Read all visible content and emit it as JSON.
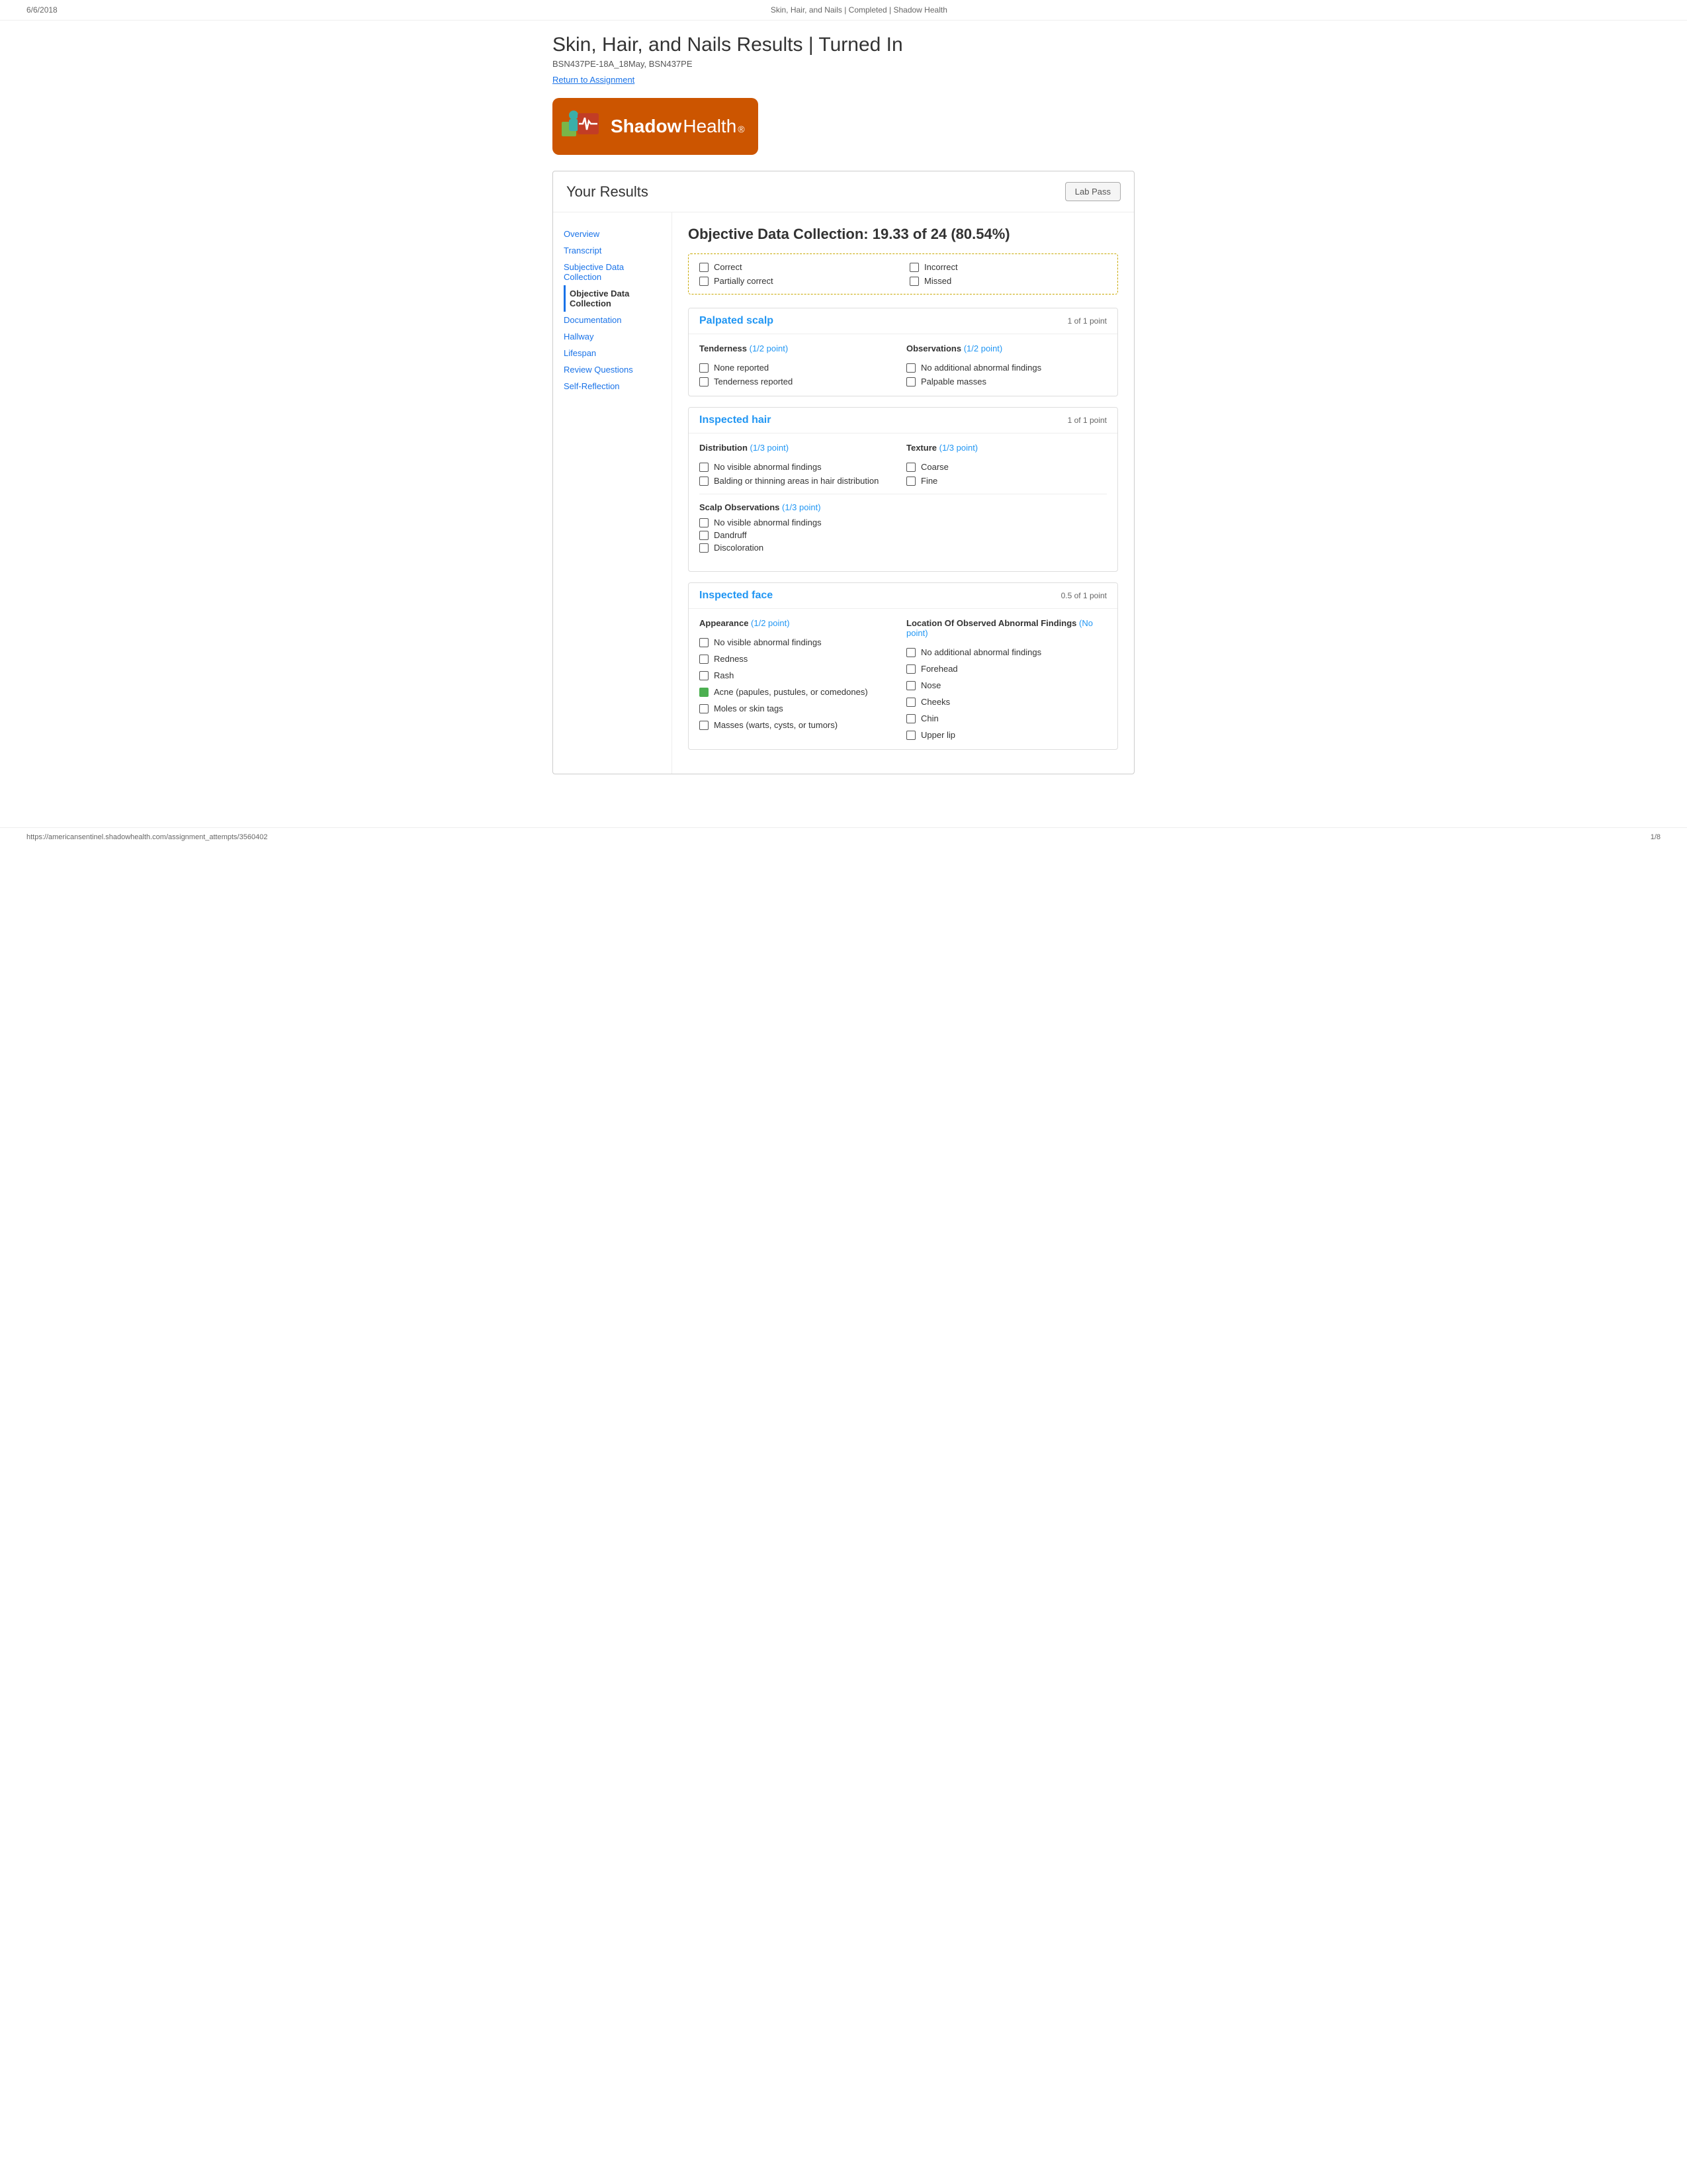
{
  "topbar": {
    "left": "6/6/2018",
    "center": "Skin, Hair, and Nails | Completed | Shadow Health"
  },
  "page": {
    "title": "Skin, Hair, and Nails Results | Turned In",
    "subtitle": "BSN437PE-18A_18May, BSN437PE",
    "return_link": "Return to Assignment"
  },
  "results": {
    "heading": "Your Results",
    "lab_pass_btn": "Lab Pass"
  },
  "sidebar": {
    "items": [
      {
        "label": "Overview",
        "active": false
      },
      {
        "label": "Transcript",
        "active": false
      },
      {
        "label": "Subjective Data Collection",
        "active": false
      },
      {
        "label": "Objective Data Collection",
        "active": true
      },
      {
        "label": "Documentation",
        "active": false
      },
      {
        "label": "Hallway",
        "active": false
      },
      {
        "label": "Lifespan",
        "active": false
      },
      {
        "label": "Review Questions",
        "active": false
      },
      {
        "label": "Self-Reflection",
        "active": false
      }
    ]
  },
  "main": {
    "section_title": "Objective Data Collection: 19.33 of 24 (80.54%)",
    "legend": {
      "correct": "Correct",
      "partially_correct": "Partially correct",
      "incorrect": "Incorrect",
      "missed": "Missed"
    },
    "cards": [
      {
        "id": "palpated-scalp",
        "title": "Palpated scalp",
        "points": "1 of 1 point",
        "subsections": [
          {
            "title": "Tenderness",
            "points_label": "(1/2 point)",
            "options": [
              "None reported",
              "Tenderness reported"
            ]
          },
          {
            "title": "Observations",
            "points_label": "(1/2 point)",
            "options": [
              "No additional abnormal findings",
              "Palpable masses"
            ]
          }
        ]
      },
      {
        "id": "inspected-hair",
        "title": "Inspected hair",
        "points": "1 of 1 point",
        "subsections": [
          {
            "title": "Distribution",
            "points_label": "(1/3 point)",
            "options": [
              "No visible abnormal findings",
              "Balding or thinning areas in hair distribution"
            ]
          },
          {
            "title": "Texture",
            "points_label": "(1/3 point)",
            "options": [
              "Coarse",
              "Fine"
            ]
          },
          {
            "title": "Scalp Observations",
            "points_label": "(1/3 point)",
            "options": [
              "No visible abnormal findings",
              "Dandruff",
              "Discoloration"
            ],
            "full_width": true
          }
        ]
      },
      {
        "id": "inspected-face",
        "title": "Inspected face",
        "points": "0.5 of 1 point",
        "subsections": [
          {
            "title": "Appearance",
            "points_label": "(1/2 point)",
            "options": [
              "No visible abnormal findings",
              "Redness",
              "Rash",
              "Acne (papules, pustules, or comedones)",
              "Moles or skin tags",
              "Masses (warts, cysts, or tumors)"
            ]
          },
          {
            "title": "Location Of Observed Abnormal Findings",
            "points_label": "(No point)",
            "options": [
              "No additional abnormal findings",
              "Forehead",
              "Nose",
              "Cheeks",
              "Chin",
              "Upper lip"
            ]
          }
        ]
      }
    ]
  },
  "bottombar": {
    "url": "https://americansentinel.shadowhealth.com/assignment_attempts/3560402",
    "page": "1/8"
  }
}
